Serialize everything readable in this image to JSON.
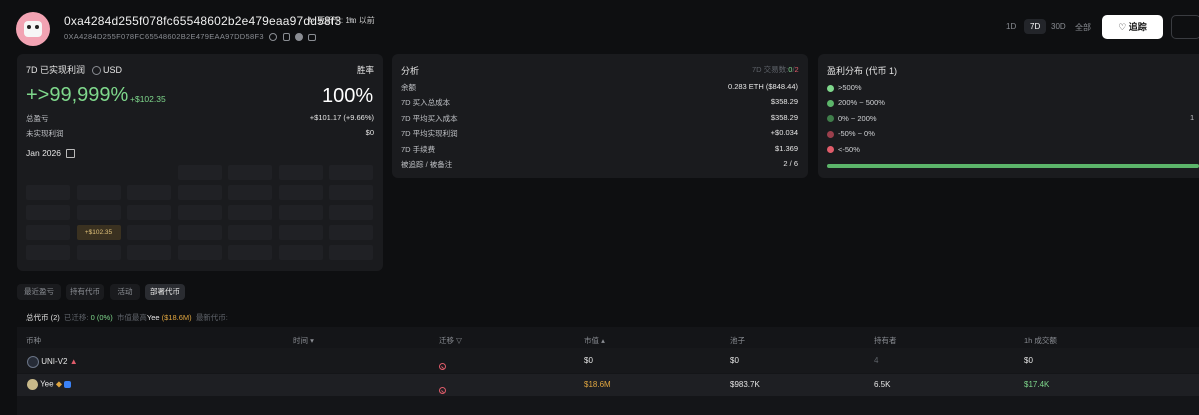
{
  "header": {
    "address": "0xa4284d255f078fc65548602b2e479eaa97dd58f3",
    "address_upper": "0XA4284D255F078FC65548602B2E479EAA97DD58F3",
    "updated": "更新于: 1m 以前",
    "ranges": [
      "1D",
      "7D",
      "30D",
      "全部"
    ],
    "active_range": "7D",
    "follow_label": "追踪"
  },
  "pnl_card": {
    "title": "7D 已实现利润",
    "currency": "USD",
    "winrate_label": "胜率",
    "pnl_percent": "+>99,999%",
    "pnl_usd": "+$102.35",
    "winrate": "100%",
    "rows": [
      {
        "label": "总盈亏",
        "value": "+$101.17 (+9.66%)"
      },
      {
        "label": "未实现利润",
        "value": "$0"
      }
    ],
    "calendar_month": "Jan 2026",
    "calendar_highlight": "+$102.35"
  },
  "analysis_card": {
    "title": "分析",
    "tx_label": "7D 交易数:",
    "tx_win": "0",
    "tx_loss": "2",
    "rows": [
      {
        "label": "余额",
        "value": "0.283 ETH ($848.44)"
      },
      {
        "label": "7D 买入总成本",
        "value": "$358.29"
      },
      {
        "label": "7D 平均买入成本",
        "value": "$358.29"
      },
      {
        "label": "7D 平均实现利润",
        "value": "+$0.034"
      },
      {
        "label": "7D 手续费",
        "value": "$1.369"
      },
      {
        "label": "被追踪 / 被备注",
        "value": "2 / 6"
      }
    ]
  },
  "dist_card": {
    "title": "盈利分布 (代币 1)",
    "items": [
      {
        "label": ">500%",
        "color": "#7fd88c"
      },
      {
        "label": "200% ~ 500%",
        "color": "#5cb56a"
      },
      {
        "label": "0% ~ 200%",
        "color": "#3f7d4a"
      },
      {
        "label": "-50% ~ 0%",
        "color": "#9b3f4c"
      },
      {
        "label": "<-50%",
        "color": "#e05c6a"
      }
    ],
    "side_value": "1"
  },
  "tabs": [
    "最近盈亏",
    "持有代币",
    "活动",
    "部署代币"
  ],
  "active_tab": "部署代币",
  "summary": {
    "total": "总代币 (2)",
    "migrated_label": "已迁移:",
    "migrated_value": "0 (0%)",
    "top_label": "市值最高",
    "top_token": "Yee",
    "top_value": "($18.6M)",
    "latest": "最新代币:"
  },
  "table": {
    "headers": [
      "币种",
      "时间",
      "迁移",
      "市值",
      "池子",
      "持有者",
      "1h 成交额"
    ],
    "rows": [
      {
        "token": "UNI-V2",
        "mcap": "$0",
        "pool": "$0",
        "holders": "4",
        "vol": "$0"
      },
      {
        "token": "Yee",
        "mcap": "$18.6M",
        "pool": "$983.7K",
        "holders": "6.5K",
        "vol": "$17.4K"
      }
    ]
  }
}
